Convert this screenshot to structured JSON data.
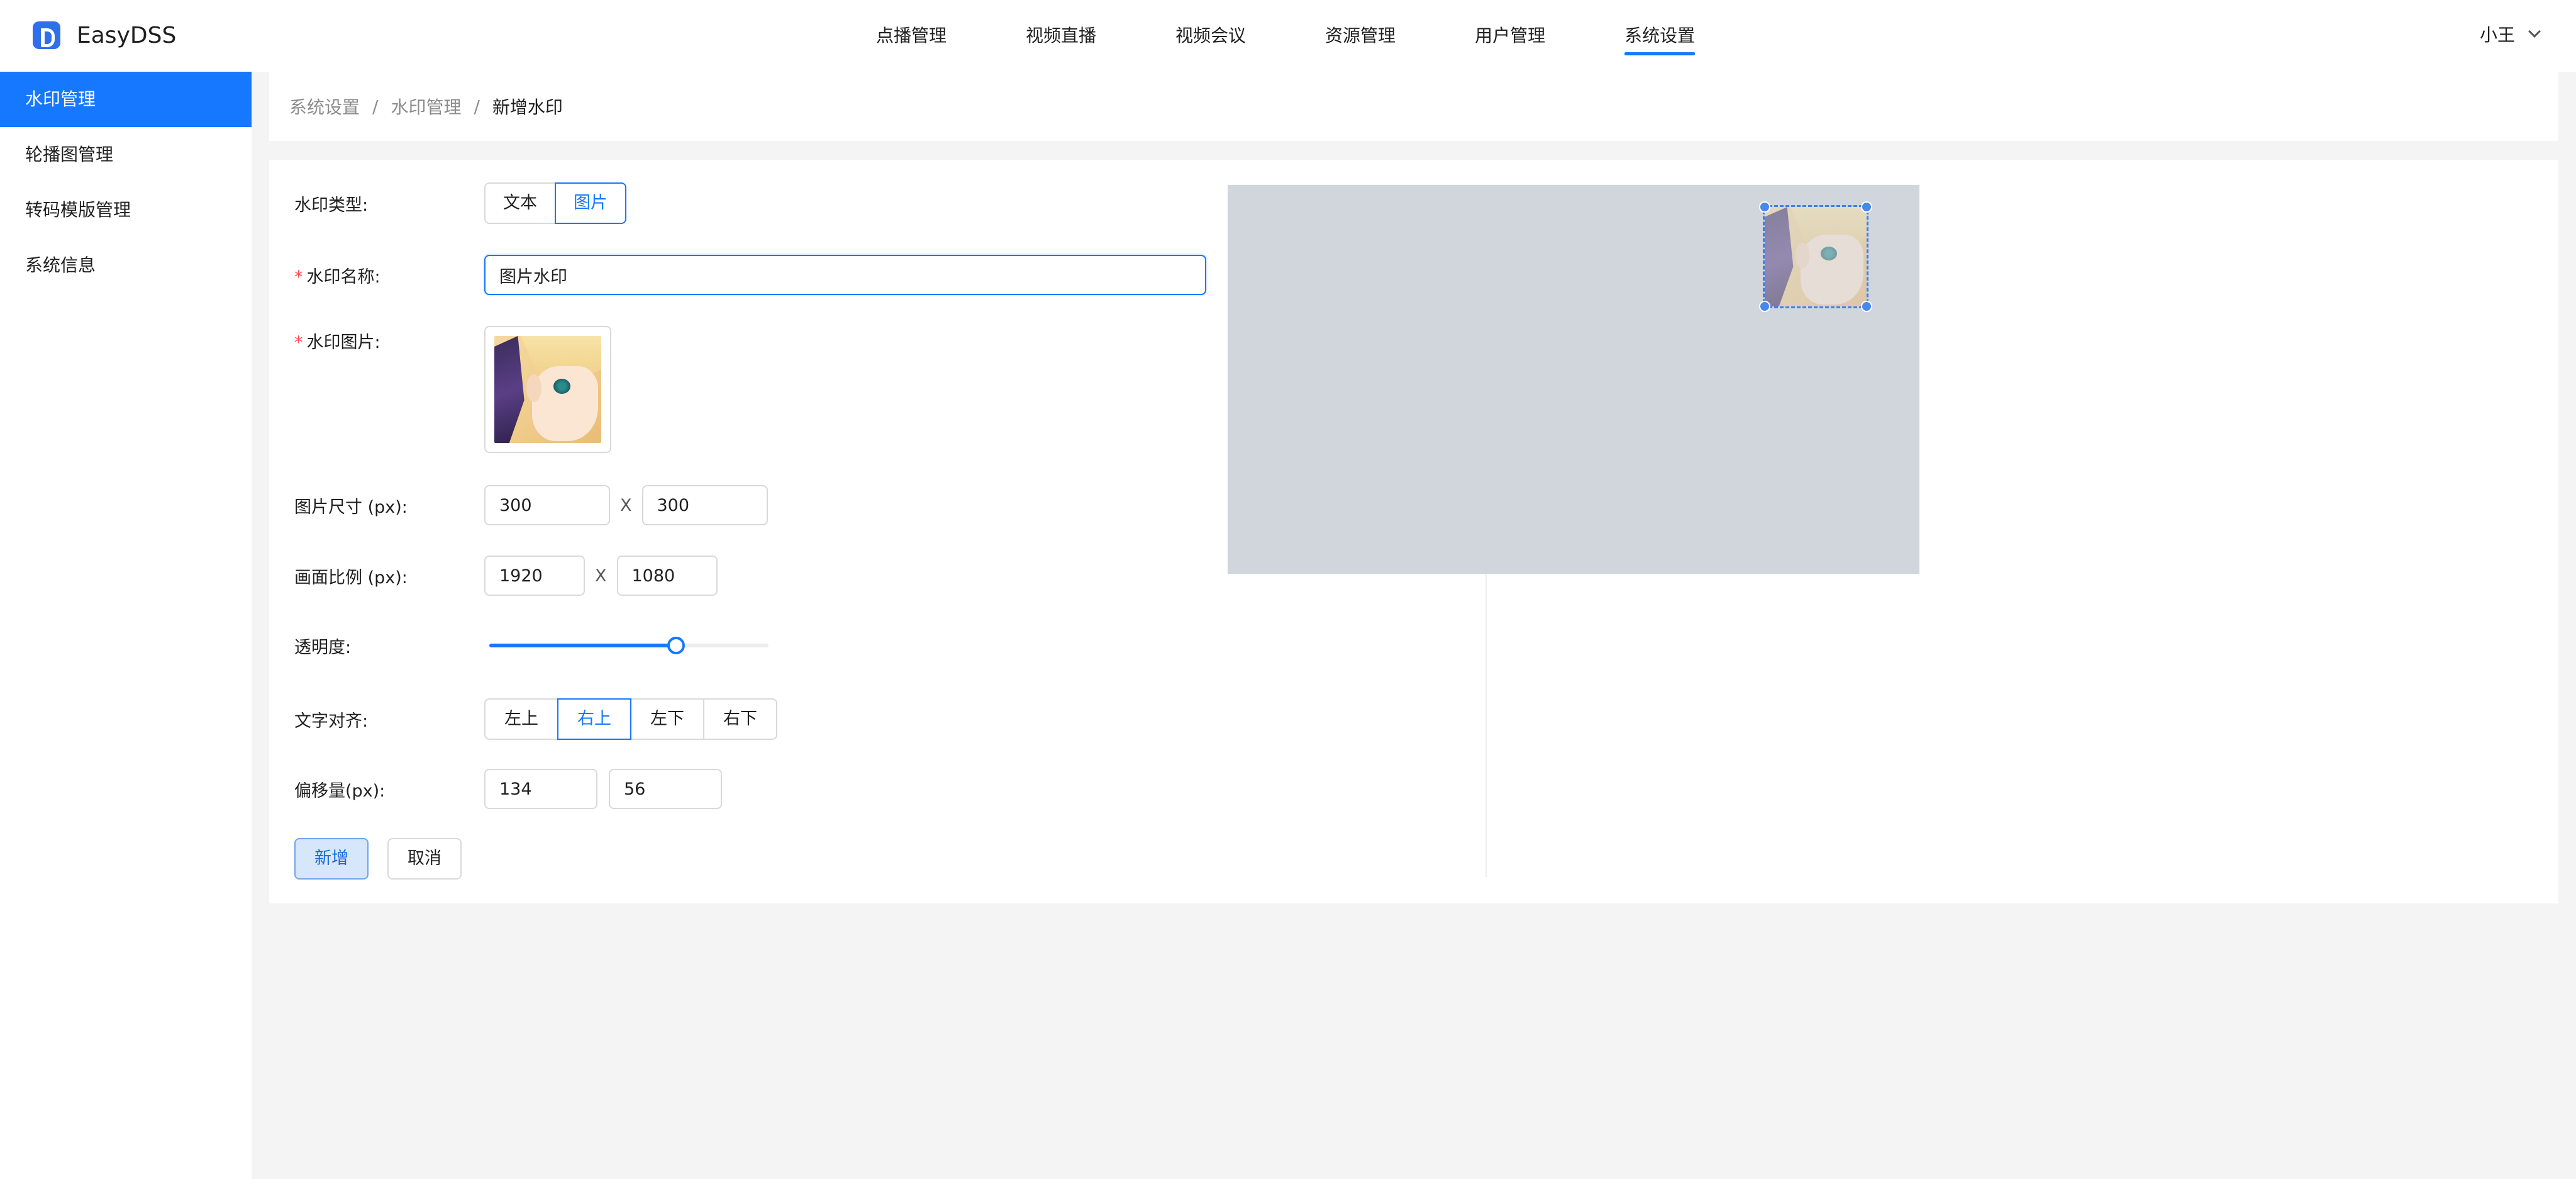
{
  "app": {
    "name": "EasyDSS"
  },
  "nav": {
    "items": [
      "点播管理",
      "视频直播",
      "视频会议",
      "资源管理",
      "用户管理",
      "系统设置"
    ],
    "active": "系统设置"
  },
  "user": {
    "name": "小王"
  },
  "sidebar": {
    "items": [
      "水印管理",
      "轮播图管理",
      "转码模版管理",
      "系统信息"
    ],
    "active": "水印管理"
  },
  "breadcrumb": {
    "items": [
      "系统设置",
      "水印管理",
      "新增水印"
    ],
    "separator": "/"
  },
  "form": {
    "type": {
      "label": "水印类型:",
      "options": [
        "文本",
        "图片"
      ],
      "selected": "图片"
    },
    "name": {
      "label": "水印名称:",
      "value": "图片水印"
    },
    "image": {
      "label": "水印图片:"
    },
    "size": {
      "label": "图片尺寸 (px):",
      "width": "300",
      "height": "300",
      "separator": "X"
    },
    "ratio": {
      "label": "画面比例 (px):",
      "width": "1920",
      "height": "1080",
      "separator": "X"
    },
    "opacity": {
      "label": "透明度:",
      "value": 0.67
    },
    "align": {
      "label": "文字对齐:",
      "options": [
        "左上",
        "右上",
        "左下",
        "右下"
      ],
      "selected": "右上"
    },
    "offset": {
      "label": "偏移量(px):",
      "x": "134",
      "y": "56"
    },
    "actions": {
      "submit": "新增",
      "cancel": "取消"
    }
  },
  "colors": {
    "primary": "#1677ff",
    "preview_bg": "#d1d5dc"
  },
  "icons": {
    "logo": "easydss-logo-icon",
    "user_menu": "chevron-down-icon"
  }
}
